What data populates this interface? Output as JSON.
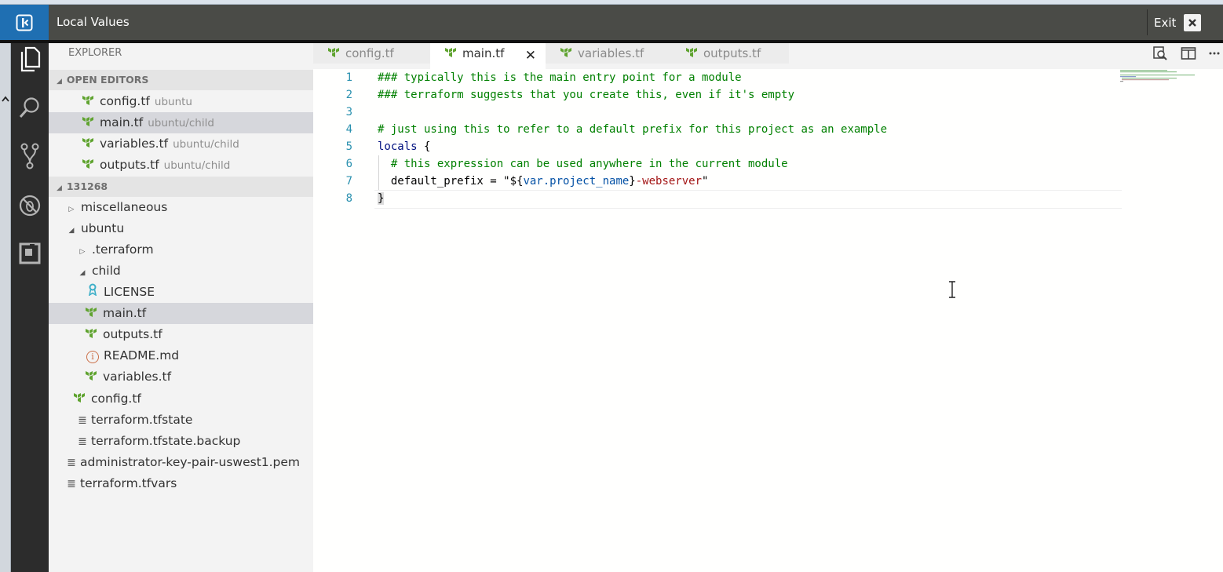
{
  "overlay": {
    "title": "Local Values",
    "exit_label": "Exit"
  },
  "sidebar": {
    "title": "EXPLORER",
    "open_editors": {
      "label": "OPEN EDITORS",
      "items": [
        {
          "name": "config.tf",
          "desc": "ubuntu"
        },
        {
          "name": "main.tf",
          "desc": "ubuntu/child"
        },
        {
          "name": "variables.tf",
          "desc": "ubuntu/child"
        },
        {
          "name": "outputs.tf",
          "desc": "ubuntu/child"
        }
      ]
    },
    "workspace": {
      "label": "131268",
      "items": [
        {
          "name": "miscellaneous"
        },
        {
          "name": "ubuntu"
        },
        {
          "name": ".terraform"
        },
        {
          "name": "child"
        },
        {
          "name": "LICENSE"
        },
        {
          "name": "main.tf"
        },
        {
          "name": "outputs.tf"
        },
        {
          "name": "README.md"
        },
        {
          "name": "variables.tf"
        },
        {
          "name": "config.tf"
        },
        {
          "name": "terraform.tfstate"
        },
        {
          "name": "terraform.tfstate.backup"
        },
        {
          "name": "administrator-key-pair-uswest1.pem"
        },
        {
          "name": "terraform.tfvars"
        }
      ]
    }
  },
  "tabs": [
    {
      "label": "config.tf"
    },
    {
      "label": "main.tf"
    },
    {
      "label": "variables.tf"
    },
    {
      "label": "outputs.tf"
    }
  ],
  "editor": {
    "line_numbers": [
      "1",
      "2",
      "3",
      "4",
      "5",
      "6",
      "7",
      "8"
    ],
    "lines": {
      "l1": "### typically this is the main entry point for a module",
      "l2": "### terraform suggests that you create this, even if it's empty",
      "l4": "# just using this to refer to a default prefix for this project as an example",
      "l5_kw": "locals",
      "l5_rest": " {",
      "l6": "  # this expression can be used anywhere in the current module",
      "l7_a": "  default_prefix = \"${",
      "l7_var": "var.project_name",
      "l7_b": "}",
      "l7_c": "-webserver",
      "l7_d": "\"",
      "l8": "}"
    }
  },
  "colors": {
    "activity_bar": "#2c2c2c",
    "overlay_header": "#4a4b47",
    "overlay_toggle": "#1f6fb2",
    "sidebar_bg": "#f3f3f3",
    "terraform_green": "#5fa32f",
    "comment_green": "#008000",
    "line_number": "#2b91af"
  },
  "icons": {
    "overlay_toggle": "panel-toggle-icon",
    "exit": "close-icon",
    "activity": [
      "files-icon",
      "search-icon",
      "source-control-icon",
      "debug-icon",
      "extensions-icon"
    ],
    "tab_actions": [
      "open-preview-icon",
      "split-editor-icon",
      "more-icon"
    ]
  }
}
